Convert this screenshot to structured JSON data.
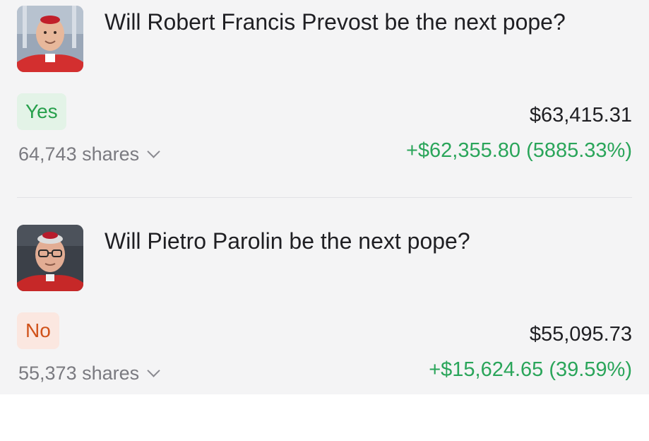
{
  "positions": [
    {
      "question": "Will Robert Francis Prevost be the next pope?",
      "outcome": "Yes",
      "shares": "64,743 shares",
      "value": "$63,415.31",
      "pnl": "+$62,355.80 (5885.33%)"
    },
    {
      "question": "Will Pietro Parolin be the next pope?",
      "outcome": "No",
      "shares": "55,373 shares",
      "value": "$55,095.73",
      "pnl": "+$15,624.65 (39.59%)"
    }
  ],
  "colors": {
    "panel_bg": "#f4f4f5",
    "yes_text": "#27a04c",
    "yes_bg": "#e3f3e7",
    "no_text": "#d0521a",
    "no_bg": "#fbe7e0",
    "gain": "#2aa55a"
  },
  "icons": {
    "shares_toggle": "chevron-down-icon"
  }
}
